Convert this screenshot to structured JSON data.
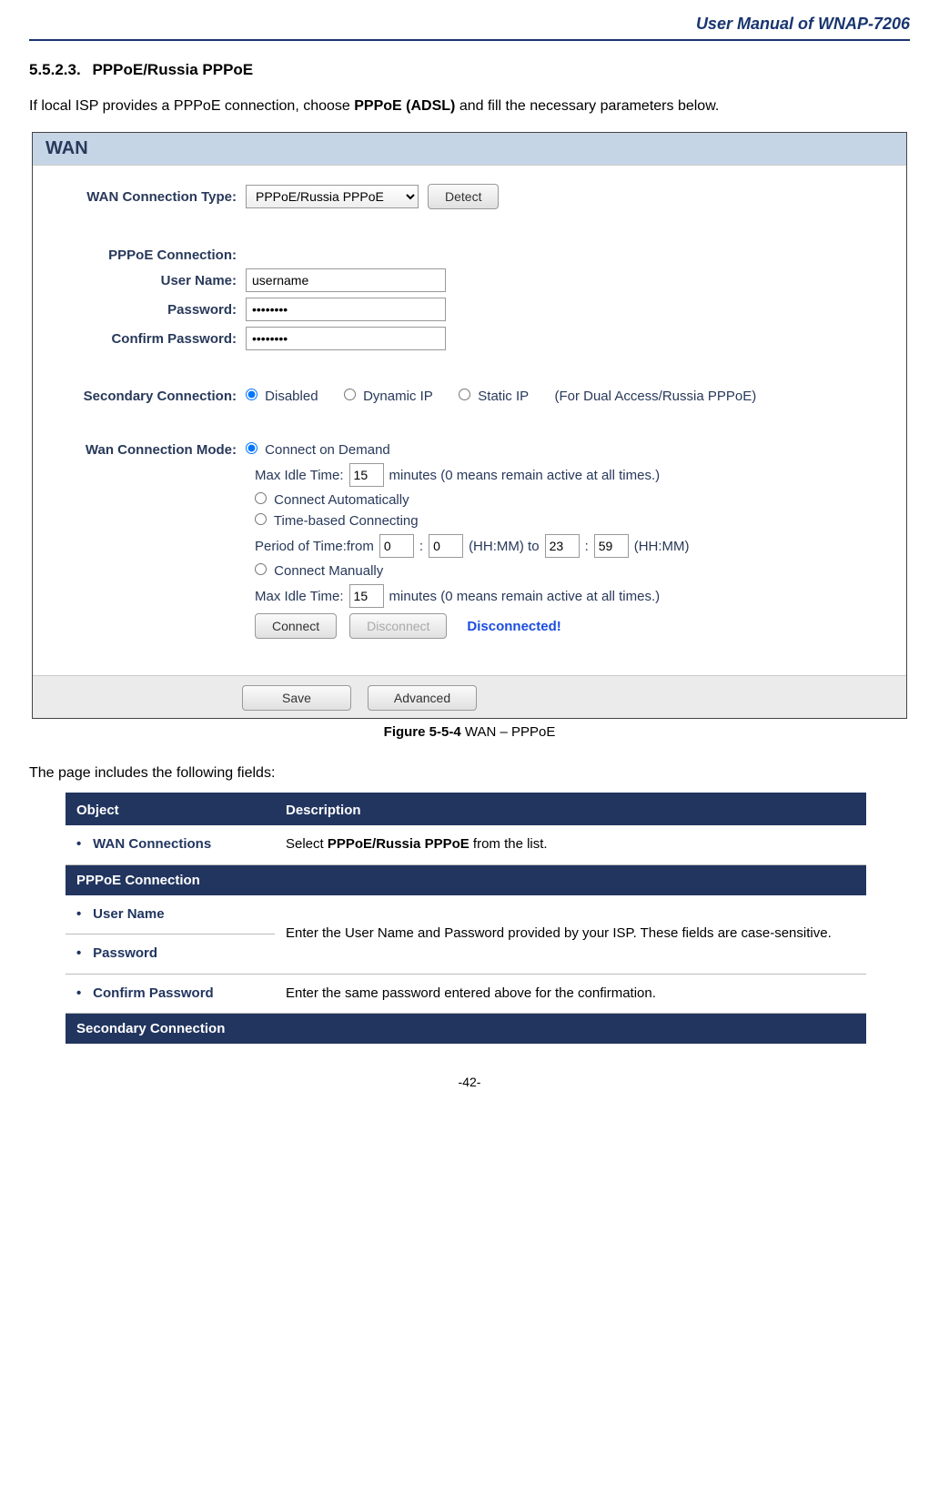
{
  "header": {
    "title": "User Manual of WNAP-7206"
  },
  "section": {
    "num": "5.5.2.3.",
    "title": "PPPoE/Russia PPPoE"
  },
  "intro": {
    "pre": "If local ISP provides a PPPoE connection, choose ",
    "bold": "PPPoE (ADSL)",
    "post": " and fill the necessary parameters below."
  },
  "wan": {
    "panel_title": "WAN",
    "labels": {
      "conn_type": "WAN Connection Type:",
      "pppoe_conn": "PPPoE Connection:",
      "username": "User Name:",
      "password": "Password:",
      "confirm": "Confirm Password:",
      "secondary": "Secondary Connection:",
      "mode": "Wan Connection Mode:"
    },
    "conn_type_value": "PPPoE/Russia PPPoE",
    "detect": "Detect",
    "username_value": "username",
    "password_value": "••••••••",
    "confirm_value": "••••••••",
    "secondary": {
      "disabled": "Disabled",
      "dynamic": "Dynamic IP",
      "static": "Static IP",
      "hint": "(For Dual Access/Russia PPPoE)"
    },
    "mode": {
      "on_demand": "Connect on Demand",
      "idle_label": "Max Idle Time:",
      "idle_value1": "15",
      "idle_unit": "minutes (0 means remain active at all times.)",
      "auto": "Connect Automatically",
      "time_based": "Time-based Connecting",
      "period_pre": "Period of Time:from",
      "period_h1": "0",
      "period_m1": "0",
      "hhmm": "(HH:MM) to",
      "period_h2": "23",
      "period_m2": "59",
      "hhmm2": "(HH:MM)",
      "manual": "Connect Manually",
      "idle_value2": "15"
    },
    "connect": "Connect",
    "disconnect": "Disconnect",
    "status": "Disconnected!",
    "save": "Save",
    "advanced": "Advanced"
  },
  "figure": {
    "bold": "Figure 5-5-4",
    "rest": " WAN – PPPoE"
  },
  "fields_intro": "The page includes the following fields:",
  "table": {
    "h1": "Object",
    "h2": "Description",
    "wan_conn": "WAN Connections",
    "wan_conn_desc_pre": "Select ",
    "wan_conn_desc_bold": "PPPoE/Russia PPPoE",
    "wan_conn_desc_post": " from the list.",
    "pppoe_conn": "PPPoE Connection",
    "username": "User Name",
    "password": "Password",
    "userpass_desc": "Enter the User Name and Password provided by your ISP. These fields are case-sensitive.",
    "confirm": "Confirm Password",
    "confirm_desc": "Enter the same password entered above for the confirmation.",
    "secondary": "Secondary Connection"
  },
  "footer": {
    "page": "-42-"
  }
}
